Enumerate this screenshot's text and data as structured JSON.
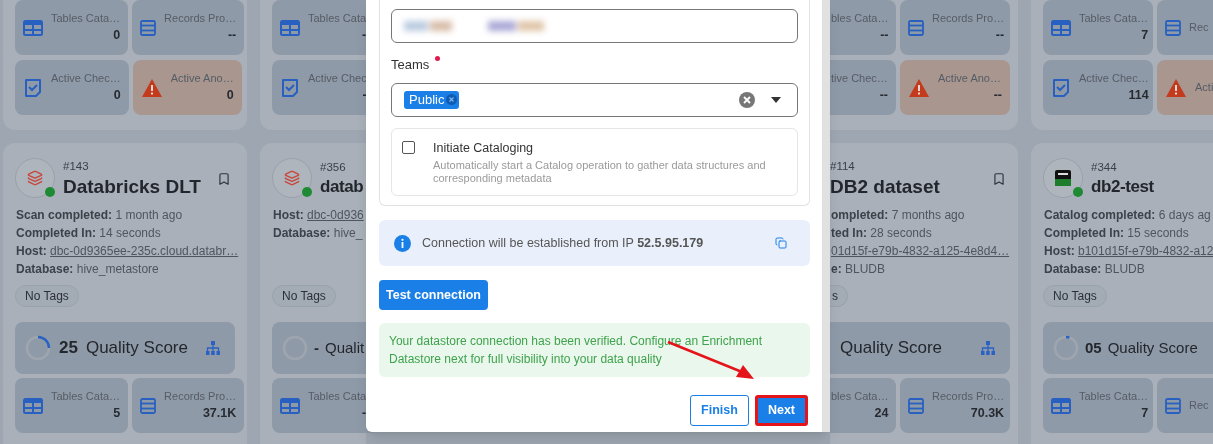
{
  "columns": [
    {
      "top_tiles": [
        [
          {
            "kind": "tables",
            "label": "Tables Cata…",
            "value": "0"
          },
          {
            "kind": "records",
            "label": "Records Pro…",
            "value": "--"
          }
        ],
        [
          {
            "kind": "checks",
            "label": "Active Chec…",
            "value": "0"
          },
          {
            "kind": "anomalies",
            "label": "Active Ano…",
            "value": "0"
          }
        ]
      ],
      "datastore": {
        "kind": "databricks",
        "number": "#143",
        "name": "Databricks DLT",
        "details": [
          {
            "kind": "text",
            "label": "Scan completed:",
            "value": "1 month ago"
          },
          {
            "kind": "text",
            "label": "Completed In:",
            "value": "14 seconds"
          },
          {
            "kind": "link",
            "label": "Host:",
            "value": "dbc-0d9365ee-235c.cloud.databr…"
          },
          {
            "kind": "text",
            "label": "Database:",
            "value": "hive_metastore"
          }
        ],
        "tags": [
          "No Tags"
        ],
        "quality": {
          "score": "25",
          "label": "Quality Score",
          "level": 0.25
        },
        "bottom_tiles": [
          {
            "kind": "tables",
            "label": "Tables Cata…",
            "value": "5"
          },
          {
            "kind": "records",
            "label": "Records Pro…",
            "value": "37.1K"
          }
        ]
      }
    },
    {
      "top_tiles": [
        [
          {
            "kind": "tables",
            "label": "Tables Cata",
            "value": "-"
          }
        ],
        [
          {
            "kind": "checks",
            "label": "Active Chec",
            "value": "-"
          }
        ]
      ],
      "datastore": {
        "kind": "databricks",
        "number": "#356",
        "name": "datab",
        "details": [
          {
            "kind": "link",
            "label": "Host:",
            "value": "dbc-0d936"
          },
          {
            "kind": "text",
            "label": "Database:",
            "value": "hive_"
          }
        ],
        "tags": [
          "No Tags"
        ],
        "quality": {
          "score": "-",
          "label": "Qualit",
          "level": 0
        },
        "bottom_tiles": [
          {
            "kind": "tables",
            "label": "Tables Cata",
            "value": "-"
          }
        ]
      }
    },
    {
      "top_tiles": [
        [
          {
            "kind": "tables",
            "label": "bles Cata…",
            "value": "--"
          },
          {
            "kind": "records",
            "label": "Records Pro…",
            "value": "--"
          }
        ],
        [
          {
            "kind": "checks",
            "label": "tive Chec…",
            "value": "--"
          },
          {
            "kind": "anomalies",
            "label": "Active Ano…",
            "value": "--"
          }
        ]
      ],
      "datastore": {
        "number": "#114",
        "name": "DB2 dataset",
        "details": [
          {
            "kind": "text",
            "label": "ompleted:",
            "value": "7 months ago"
          },
          {
            "kind": "text",
            "label": "ted In:",
            "value": "28 seconds"
          },
          {
            "kind": "link",
            "value": "01d15f-e79b-4832-a125-4e8d4…"
          },
          {
            "kind": "text",
            "label": "e:",
            "value": "BLUDB"
          }
        ],
        "tags": [
          "s"
        ],
        "quality": {
          "label": "Quality Score"
        },
        "bottom_tiles": [
          {
            "kind": "tables",
            "label": "bles Cata…",
            "value": "24"
          },
          {
            "kind": "records",
            "label": "Records Pro…",
            "value": "70.3K"
          }
        ]
      }
    },
    {
      "top_tiles": [
        [
          {
            "kind": "tables",
            "label": "Tables Cata…",
            "value": "7"
          },
          {
            "kind": "records",
            "label": "Rec"
          }
        ],
        [
          {
            "kind": "checks",
            "label": "Active Chec…",
            "value": "114"
          },
          {
            "kind": "anomalies",
            "label": "Acti"
          }
        ]
      ],
      "datastore": {
        "kind": "db2",
        "number": "#344",
        "name": "db2-test",
        "details": [
          {
            "kind": "text",
            "label": "Catalog completed:",
            "value": "6 days ag"
          },
          {
            "kind": "text",
            "label": "Completed In:",
            "value": "15 seconds"
          },
          {
            "kind": "link",
            "label": "Host:",
            "value": "b101d15f-e79b-4832-a12"
          },
          {
            "kind": "text",
            "label": "Database:",
            "value": "BLUDB"
          }
        ],
        "tags": [
          "No Tags"
        ],
        "quality": {
          "score": "05",
          "label": "Quality Score",
          "level": 0.05
        },
        "bottom_tiles": [
          {
            "kind": "tables",
            "label": "Tables Cata…",
            "value": "7"
          },
          {
            "kind": "records",
            "label": "Rec"
          }
        ]
      }
    }
  ],
  "dialog": {
    "value_field": {
      "redacted": true
    },
    "teams": {
      "label": "Teams",
      "required": true,
      "chips": [
        "Public"
      ]
    },
    "cataloging": {
      "title": "Initiate Cataloging",
      "description": "Automatically start a Catalog operation to gather data structures and corresponding metadata",
      "checked": false
    },
    "info": "Connection will be established from IP **52.5.95.179**",
    "test_button": "Test connection",
    "success": "Your datastore connection has been verified. Configure an Enrichment Datastore next for full visibility into your data quality",
    "buttons": [
      {
        "label": "Finish",
        "kind": "outline",
        "highlighted": false
      },
      {
        "label": "Next",
        "kind": "primary",
        "highlighted": true
      }
    ]
  }
}
